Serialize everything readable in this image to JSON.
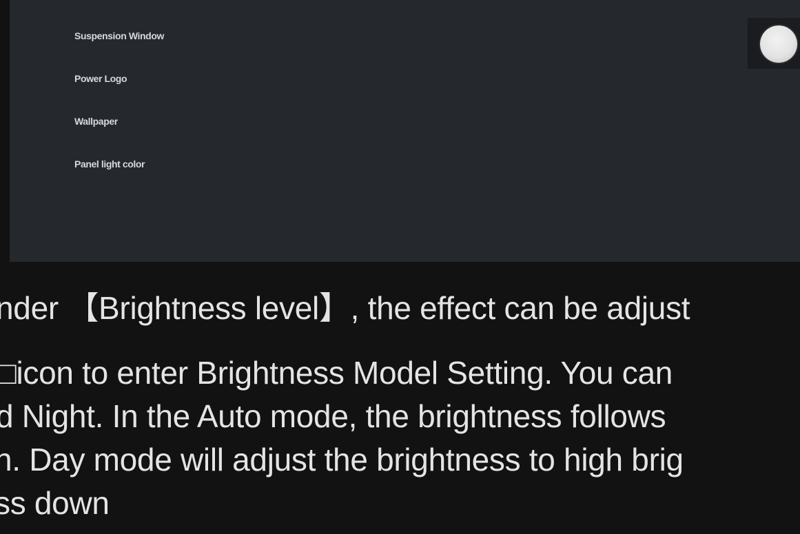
{
  "settings": {
    "items": [
      {
        "label": "Suspension Window"
      },
      {
        "label": "Power Logo"
      },
      {
        "label": "Wallpaper"
      },
      {
        "label": "Panel light color"
      }
    ]
  },
  "manual": {
    "lines": [
      "nder 【Brightness level】, the effect can be adjust",
      "□icon to enter Brightness Model Setting. You can",
      "d Night. In the Auto mode, the brightness follows",
      "n. Day mode will adjust the brightness to high brig",
      "ss down"
    ]
  }
}
